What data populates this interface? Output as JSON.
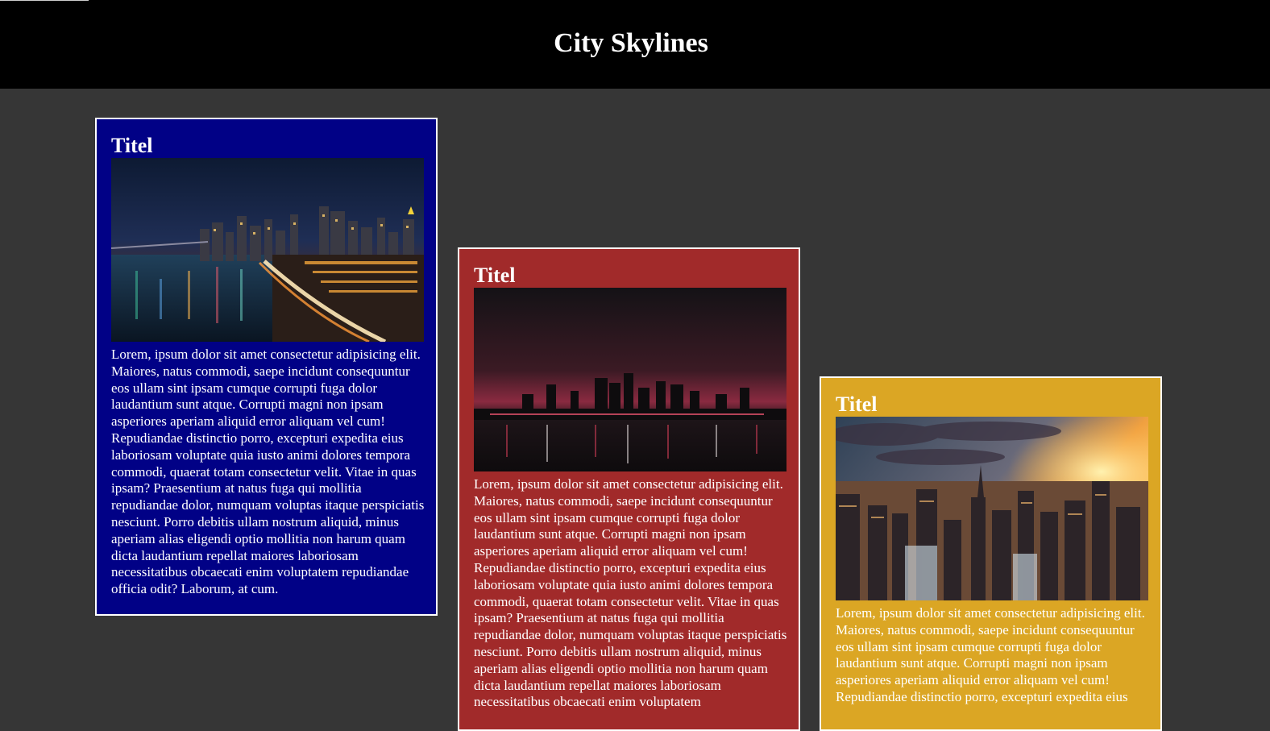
{
  "header": {
    "title": "City Skylines"
  },
  "cards": [
    {
      "title": "Titel",
      "image_desc": "night-skyline-river-highway",
      "bg_color": "#010186",
      "text": "Lorem, ipsum dolor sit amet consectetur adipisicing elit. Maiores, natus commodi, saepe incidunt consequuntur eos ullam sint ipsam cumque corrupti fuga dolor laudantium sunt atque. Corrupti magni non ipsam asperiores aperiam aliquid error aliquam vel cum! Repudiandae distinctio porro, excepturi expedita eius laboriosam voluptate quia iusto animi dolores tempora commodi, quaerat totam consectetur velit. Vitae in quas ipsam? Praesentium at natus fuga qui mollitia repudiandae dolor, numquam voluptas itaque perspiciatis nesciunt. Porro debitis ullam nostrum aliquid, minus aperiam alias eligendi optio mollitia non harum quam dicta laudantium repellat maiores laboriosam necessitatibus obcaecati enim voluptatem repudiandae officia odit? Laborum, at cum."
    },
    {
      "title": "Titel",
      "image_desc": "dusk-skyline-red-sky",
      "bg_color": "#a12a2a",
      "text": "Lorem, ipsum dolor sit amet consectetur adipisicing elit. Maiores, natus commodi, saepe incidunt consequuntur eos ullam sint ipsam cumque corrupti fuga dolor laudantium sunt atque. Corrupti magni non ipsam asperiores aperiam aliquid error aliquam vel cum! Repudiandae distinctio porro, excepturi expedita eius laboriosam voluptate quia iusto animi dolores tempora commodi, quaerat totam consectetur velit. Vitae in quas ipsam? Praesentium at natus fuga qui mollitia repudiandae dolor, numquam voluptas itaque perspiciatis nesciunt. Porro debitis ullam nostrum aliquid, minus aperiam alias eligendi optio mollitia non harum quam dicta laudantium repellat maiores laboriosam necessitatibus obcaecati enim voluptatem"
    },
    {
      "title": "Titel",
      "image_desc": "sunset-city-aerial",
      "bg_color": "#dba624",
      "text": "Lorem, ipsum dolor sit amet consectetur adipisicing elit. Maiores, natus commodi, saepe incidunt consequuntur eos ullam sint ipsam cumque corrupti fuga dolor laudantium sunt atque. Corrupti magni non ipsam asperiores aperiam aliquid error aliquam vel cum! Repudiandae distinctio porro, excepturi expedita eius"
    }
  ]
}
